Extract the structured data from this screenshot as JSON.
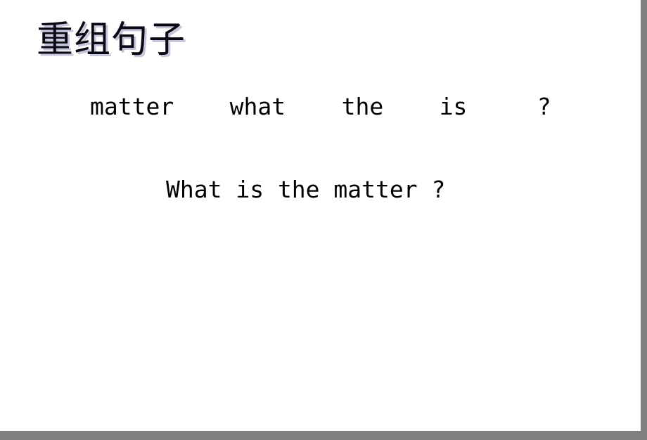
{
  "slide": {
    "title": "重组句子",
    "background_color": "#ffffff",
    "frame_shadow_color": "#808080",
    "title_color": "#0a0a14",
    "title_shadow_color": "#c6c6dc",
    "body_text_color": "#000000"
  },
  "content": {
    "scrambled_sentence": "matter    what    the    is     ?",
    "answer_sentence": "What is the matter ?",
    "scrambled_words": [
      "matter",
      "what",
      "the",
      "is",
      "?"
    ],
    "answer_words": [
      "What",
      "is",
      "the",
      "matter",
      "?"
    ]
  }
}
